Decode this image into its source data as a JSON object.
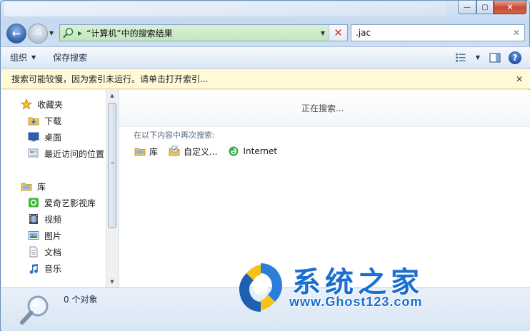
{
  "window": {
    "caption_buttons": {
      "minimize": "—",
      "maximize": "▢",
      "close": "✕"
    }
  },
  "address": {
    "path": "“计算机”中的搜索结果",
    "icon": "search-folder-icon"
  },
  "search": {
    "query": ".jac"
  },
  "toolbar": {
    "organize": "组织",
    "save_search": "保存搜索"
  },
  "info_bar": {
    "message": "搜索可能较慢，因为索引未运行。请单击打开索引..."
  },
  "sidebar": {
    "favorites": {
      "label": "收藏夹",
      "items": [
        {
          "label": "下载",
          "icon": "downloads-folder-icon"
        },
        {
          "label": "桌面",
          "icon": "desktop-icon"
        },
        {
          "label": "最近访问的位置",
          "icon": "recent-places-icon"
        }
      ]
    },
    "libraries": {
      "label": "库",
      "items": [
        {
          "label": "爱奇艺影视库",
          "icon": "iqiyi-library-icon"
        },
        {
          "label": "视频",
          "icon": "videos-icon"
        },
        {
          "label": "图片",
          "icon": "pictures-icon"
        },
        {
          "label": "文档",
          "icon": "documents-icon"
        },
        {
          "label": "音乐",
          "icon": "music-icon"
        }
      ]
    }
  },
  "content": {
    "status": "正在搜索...",
    "search_again_label": "在以下内容中再次搜索:",
    "search_again_items": [
      {
        "label": "库",
        "icon": "library-icon"
      },
      {
        "label": "自定义...",
        "icon": "custom-folder-icon"
      },
      {
        "label": "Internet",
        "icon": "internet-icon"
      }
    ]
  },
  "details": {
    "count": "0 个对象"
  },
  "watermark": {
    "title": "系统之家",
    "url": "www.Ghost123.com"
  },
  "colors": {
    "accent": "#1b6fd0",
    "info_bar": "#fff9d8",
    "address_green": "#c3e6bd"
  }
}
